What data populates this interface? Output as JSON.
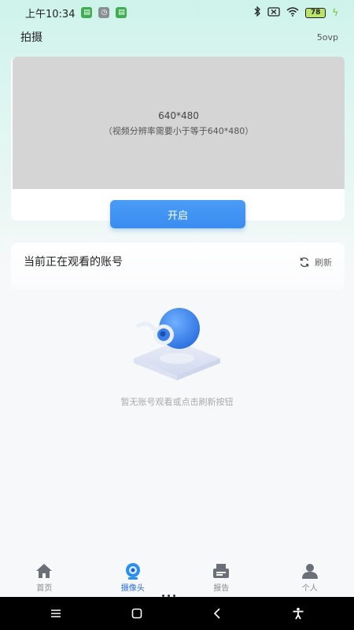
{
  "status_bar": {
    "time": "上午10:34",
    "battery": "78"
  },
  "header": {
    "title": "拍摄",
    "version": "5ovp"
  },
  "video": {
    "resolution": "640*480",
    "hint": "（视频分辨率需要小于等于640*480）",
    "start_label": "开启"
  },
  "watching": {
    "title": "当前正在观看的账号",
    "refresh_label": "刷新",
    "empty_text": "暂无账号观看或点击刷新按钮"
  },
  "tabs": [
    {
      "label": "首页",
      "icon": "home-icon",
      "active": false
    },
    {
      "label": "摄像头",
      "icon": "camera-icon",
      "active": true
    },
    {
      "label": "报告",
      "icon": "report-icon",
      "active": false
    },
    {
      "label": "个人",
      "icon": "person-icon",
      "active": false
    }
  ],
  "colors": {
    "accent": "#3a8cf0",
    "tab_active": "#2b6ef0"
  }
}
